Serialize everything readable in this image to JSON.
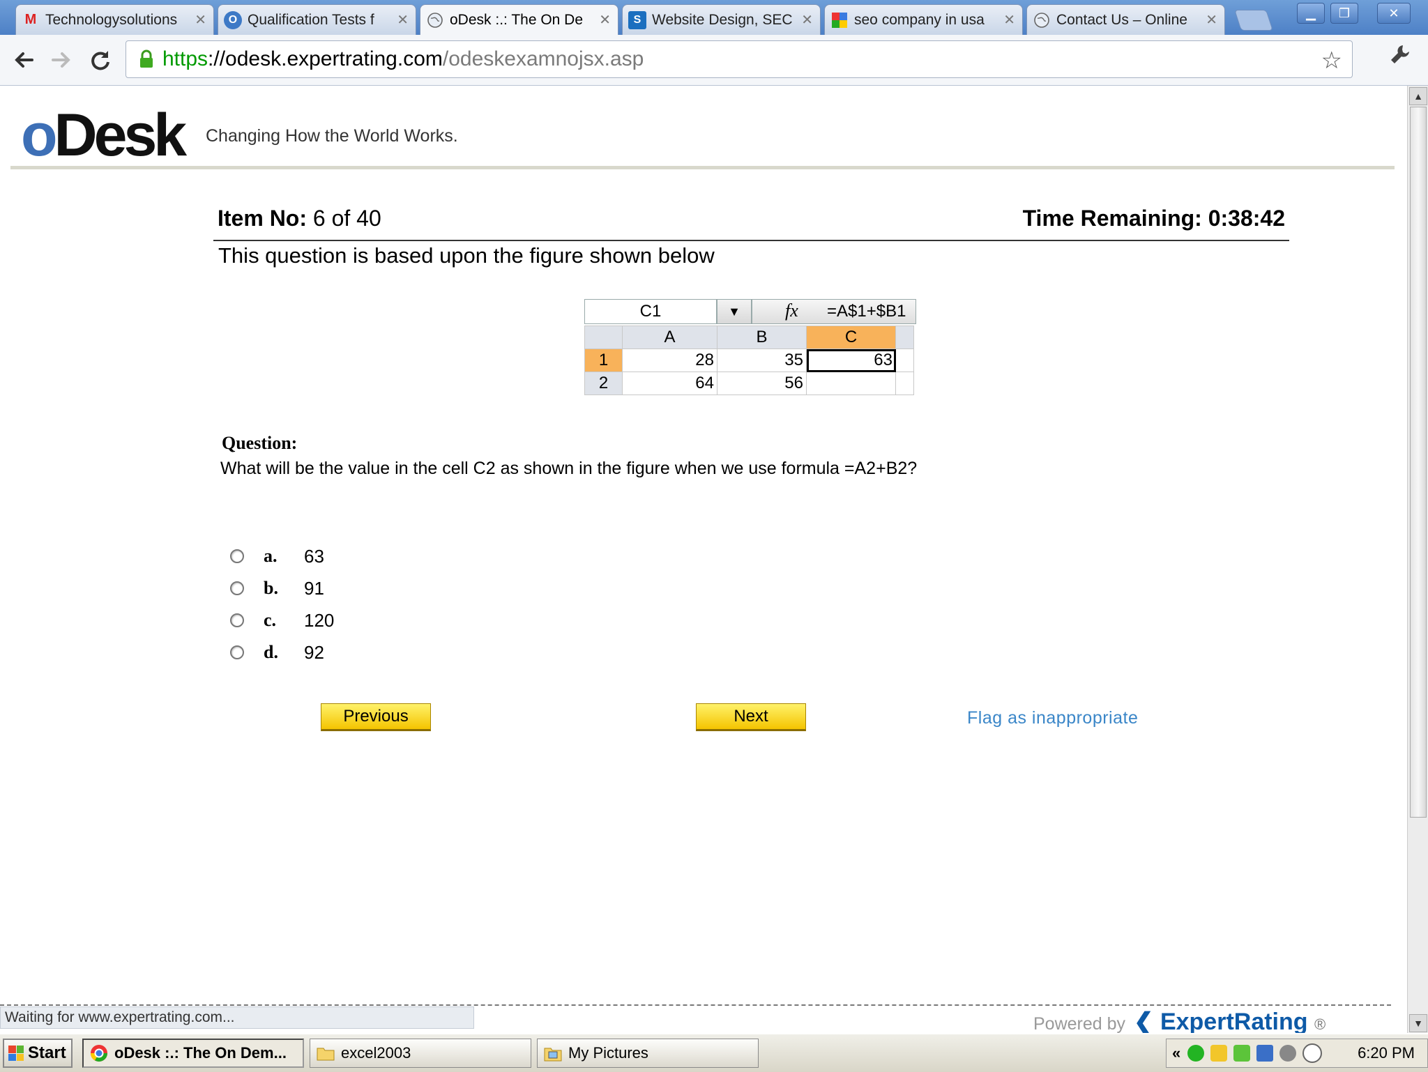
{
  "browser": {
    "tabs": [
      {
        "label": "Technologysolutions",
        "icon": "gmail-icon",
        "active": false
      },
      {
        "label": "Qualification Tests f",
        "icon": "odesk-icon",
        "active": false
      },
      {
        "label": "oDesk :.: The On De",
        "icon": "globe-icon",
        "active": true
      },
      {
        "label": "Website Design, SEC",
        "icon": "site-icon",
        "active": false
      },
      {
        "label": "seo company in usa",
        "icon": "google-icon",
        "active": false
      },
      {
        "label": "Contact Us – Online",
        "icon": "globe-icon",
        "active": false
      }
    ],
    "url": {
      "scheme": "https",
      "host": "://odesk.expertrating.com",
      "path": "/odeskexamnojsx.asp"
    }
  },
  "header": {
    "logo_o": "o",
    "logo_rest": "Desk",
    "tagline": "Changing How the World Works."
  },
  "test": {
    "item_label": "Item No:",
    "item_value": "6 of 40",
    "time_remaining": "Time Remaining: 0:38:42",
    "intro": "This question is based upon the figure shown below"
  },
  "figure": {
    "name_box": "C1",
    "fx": "fx",
    "formula": "=A$1+$B1",
    "columns": [
      "A",
      "B",
      "C"
    ],
    "rows": [
      {
        "header": "1",
        "cells": [
          "28",
          "35",
          "63"
        ]
      },
      {
        "header": "2",
        "cells": [
          "64",
          "56",
          ""
        ]
      }
    ]
  },
  "question": {
    "label": "Question:",
    "text": "What will be the value in the cell C2 as shown in the figure when we use formula =A2+B2?",
    "options": [
      {
        "letter": "a.",
        "value": "63"
      },
      {
        "letter": "b.",
        "value": "91"
      },
      {
        "letter": "c.",
        "value": "120"
      },
      {
        "letter": "d.",
        "value": "92"
      }
    ]
  },
  "buttons": {
    "previous": "Previous",
    "next": "Next",
    "flag": "Flag as inappropriate"
  },
  "footer": {
    "status": "Waiting for www.expertrating.com...",
    "powered_by": "Powered by",
    "brand": "ExpertRating",
    "reg": "®"
  },
  "taskbar": {
    "start": "Start",
    "items": [
      {
        "label": "oDesk :.: The On Dem...",
        "icon": "chrome-icon",
        "active": true
      },
      {
        "label": "excel2003",
        "icon": "folder-icon",
        "active": false
      },
      {
        "label": "My Pictures",
        "icon": "pictures-icon",
        "active": false
      }
    ],
    "tray_expand": "«",
    "clock": "6:20 PM"
  }
}
